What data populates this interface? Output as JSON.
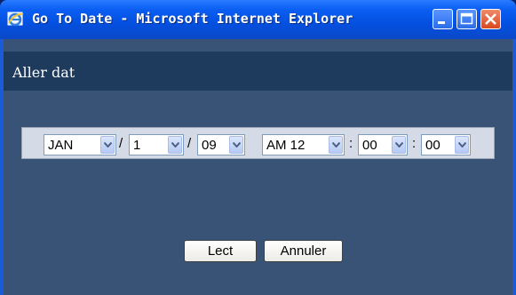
{
  "window": {
    "title": "Go To Date - Microsoft Internet Explorer"
  },
  "header": {
    "title": "Aller dat"
  },
  "date_selector": {
    "month": "JAN",
    "day": "1",
    "year": "09",
    "date_separator": "/",
    "hour": "AM 12",
    "minute": "00",
    "second": "00",
    "time_separator": ":"
  },
  "buttons": {
    "read_label": "Lect",
    "cancel_label": "Annuler"
  },
  "colors": {
    "content_bg": "#385376",
    "header_bg": "#1e3a5c",
    "titlebar": "#0450e0"
  }
}
